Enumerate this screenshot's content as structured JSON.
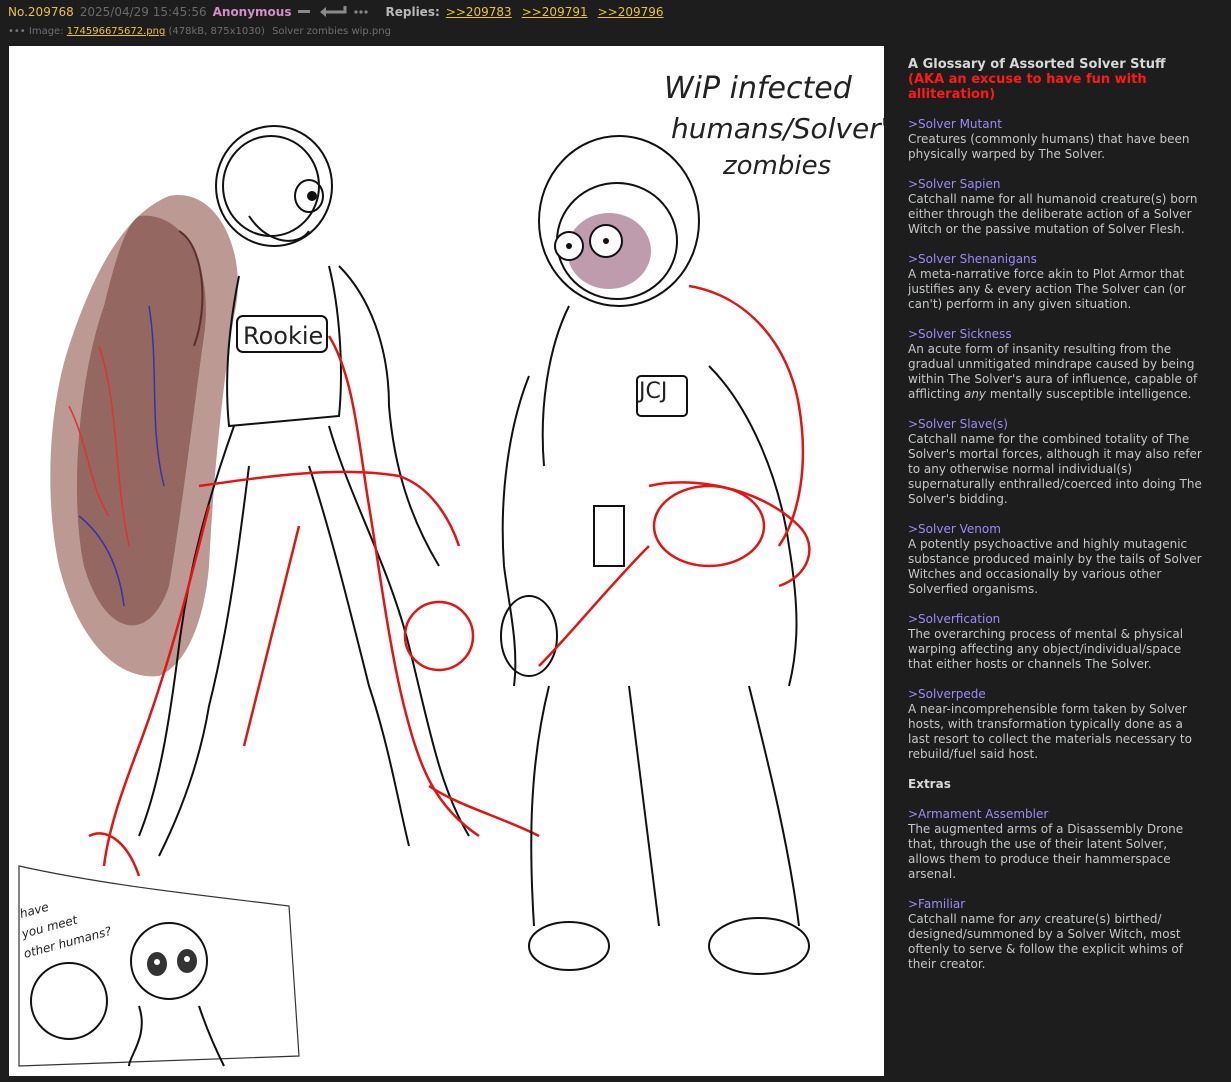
{
  "post": {
    "number": "No.209768",
    "date": "2025/04/29 15:45:56",
    "name": "Anonymous",
    "replies_label": "Replies:",
    "replies": [
      ">>209783",
      ">>209791",
      ">>209796"
    ],
    "file_label": "Image:",
    "file_name": "174596675672.png",
    "file_meta": "(478kB, 875x1030)",
    "file_original": "Solver zombies wip.png",
    "icons": [
      "minus-icon",
      "reply-arrow-icon",
      "more-dots-icon"
    ]
  },
  "drawing": {
    "title_lines": [
      "WiP infected",
      "humans/Solver'd",
      "zombies"
    ],
    "badge_rookie": "Rookie",
    "badge_jcj": "JCJ",
    "doodle_caption": [
      "have",
      "you meet",
      "other humans?"
    ]
  },
  "glossary": {
    "title": "A Glossary of Assorted Solver Stuff",
    "subtitle_line1": "(AKA an excuse to have fun with",
    "subtitle_line2": "alliteration)",
    "terms": [
      {
        "name": ">Solver Mutant",
        "desc": "Creatures (commonly humans) that have been physically warped by The Solver."
      },
      {
        "name": ">Solver Sapien",
        "desc": "Catchall name for all humanoid creature(s) born either through the deliberate action of a Solver Witch or the passive mutation of Solver Flesh."
      },
      {
        "name": ">Solver Shenanigans",
        "desc": "A meta-narrative force akin to Plot Armor that justifies any & every action The Solver can (or can't) perform in any given situation."
      },
      {
        "name": ">Solver Sickness",
        "desc_before": "An acute form of insanity resulting from the gradual unmitigated mindrape caused by being within The Solver's aura of influence, capable of afflicting ",
        "desc_em": "any",
        "desc_after": " mentally susceptible intelligence."
      },
      {
        "name": ">Solver Slave(s)",
        "desc": "Catchall name for the combined totality of The Solver's mortal forces, although it may also refer to any otherwise normal individual(s) supernaturally enthralled/coerced into doing The Solver's bidding."
      },
      {
        "name": ">Solver Venom",
        "desc": "A potently psychoactive and highly mutagenic substance produced mainly by the tails of Solver Witches and occasionally by various other Solverfied organisms."
      },
      {
        "name": ">Solverfication",
        "desc": "The overarching process of mental & physical warping affecting any object/individual/space that either hosts or channels The Solver."
      },
      {
        "name": ">Solverpede",
        "desc": "A near-incomprehensible form taken by Solver hosts, with transformation typically done as a last resort to collect the materials necessary to rebuild/fuel said host."
      }
    ],
    "extras_label": "Extras",
    "extras": [
      {
        "name": ">Armament Assembler",
        "desc": "The augmented arms of a Disassembly Drone that, through the use of their latent Solver, allows them to produce their hammerspace arsenal."
      },
      {
        "name": ">Familiar",
        "desc_before": "Catchall name for ",
        "desc_em": "any",
        "desc_after": " creature(s) birthed/ designed/summoned by a Solver Witch, most oftenly to serve & follow the explicit whims of their creator."
      }
    ]
  }
}
